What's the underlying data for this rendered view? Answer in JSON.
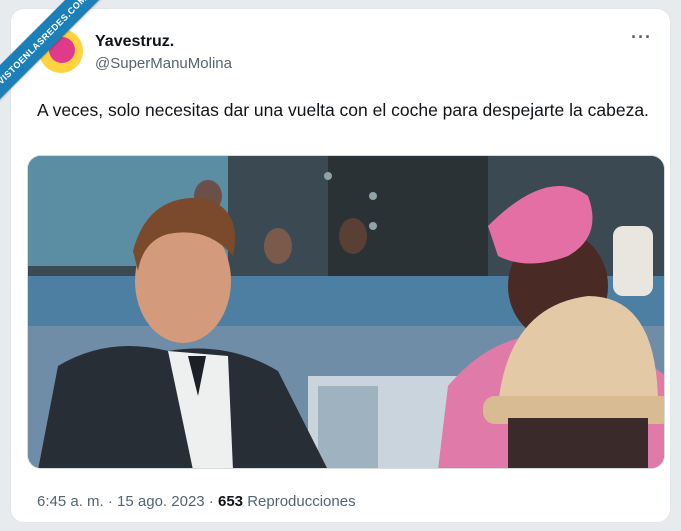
{
  "watermark": {
    "text": "VISTOENLASREDES.COM"
  },
  "tweet": {
    "display_name": "Yavestruz.",
    "handle": "@SuperManuMolina",
    "more_label": "···",
    "text": "A veces, solo necesitas dar una vuelta con el coche para despejarte la cabeza.",
    "time": "6:45 a. m.",
    "separator": " · ",
    "date": "15 ago. 2023",
    "views_count": "653",
    "views_label": "Reproducciones"
  },
  "colors": {
    "ribbon": "#1d7fb8",
    "avatar_bg": "#ffd23f",
    "avatar_inner": "#e03b8b",
    "text_primary": "#0f1419",
    "text_secondary": "#536471"
  },
  "icons": {
    "more": "more-dots-icon"
  }
}
